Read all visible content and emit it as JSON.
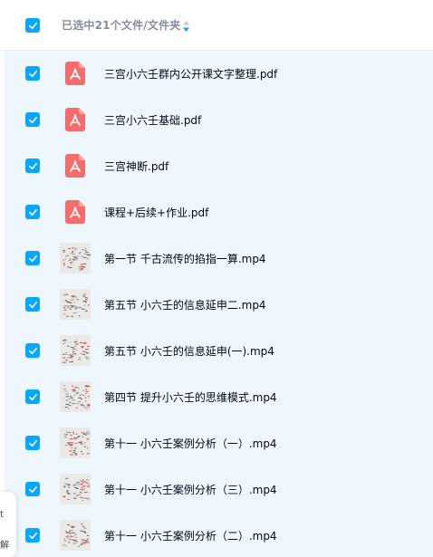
{
  "header": {
    "selection_text": "已选中21个文件/文件夹",
    "sort_icon": "sort-updown-icon"
  },
  "colors": {
    "accent": "#06a7ff",
    "row_selected_bg": "#eef7fe",
    "pdf_red": "#f56c6c",
    "header_text": "#878c9c"
  },
  "files": [
    {
      "name": "三宫小六壬群内公开课文字整理.pdf",
      "type": "pdf",
      "checked": true,
      "icon": "pdf-icon"
    },
    {
      "name": "三宫小六壬基础.pdf",
      "type": "pdf",
      "checked": true,
      "icon": "pdf-icon"
    },
    {
      "name": "三宫神断.pdf",
      "type": "pdf",
      "checked": true,
      "icon": "pdf-icon"
    },
    {
      "name": "课程+后续+作业.pdf",
      "type": "pdf",
      "checked": true,
      "icon": "pdf-icon"
    },
    {
      "name": "第一节 千古流传的掐指一算.mp4",
      "type": "mp4",
      "checked": true,
      "icon": "video-thumbnail"
    },
    {
      "name": "第五节 小六壬的信息延申二.mp4",
      "type": "mp4",
      "checked": true,
      "icon": "video-thumbnail"
    },
    {
      "name": "第五节 小六壬的信息延申(一).mp4",
      "type": "mp4",
      "checked": true,
      "icon": "video-thumbnail"
    },
    {
      "name": "第四节 提升小六壬的思维模式.mp4",
      "type": "mp4",
      "checked": true,
      "icon": "video-thumbnail"
    },
    {
      "name": "第十一 小六壬案例分析（一）.mp4",
      "type": "mp4",
      "checked": true,
      "icon": "video-thumbnail"
    },
    {
      "name": "第十一 小六壬案例分析（三）.mp4",
      "type": "mp4",
      "checked": true,
      "icon": "video-thumbnail"
    },
    {
      "name": "第十一 小六壬案例分析（二）.mp4",
      "type": "mp4",
      "checked": true,
      "icon": "video-thumbnail"
    }
  ],
  "left_tab": {
    "chars": [
      "t",
      "解"
    ]
  }
}
